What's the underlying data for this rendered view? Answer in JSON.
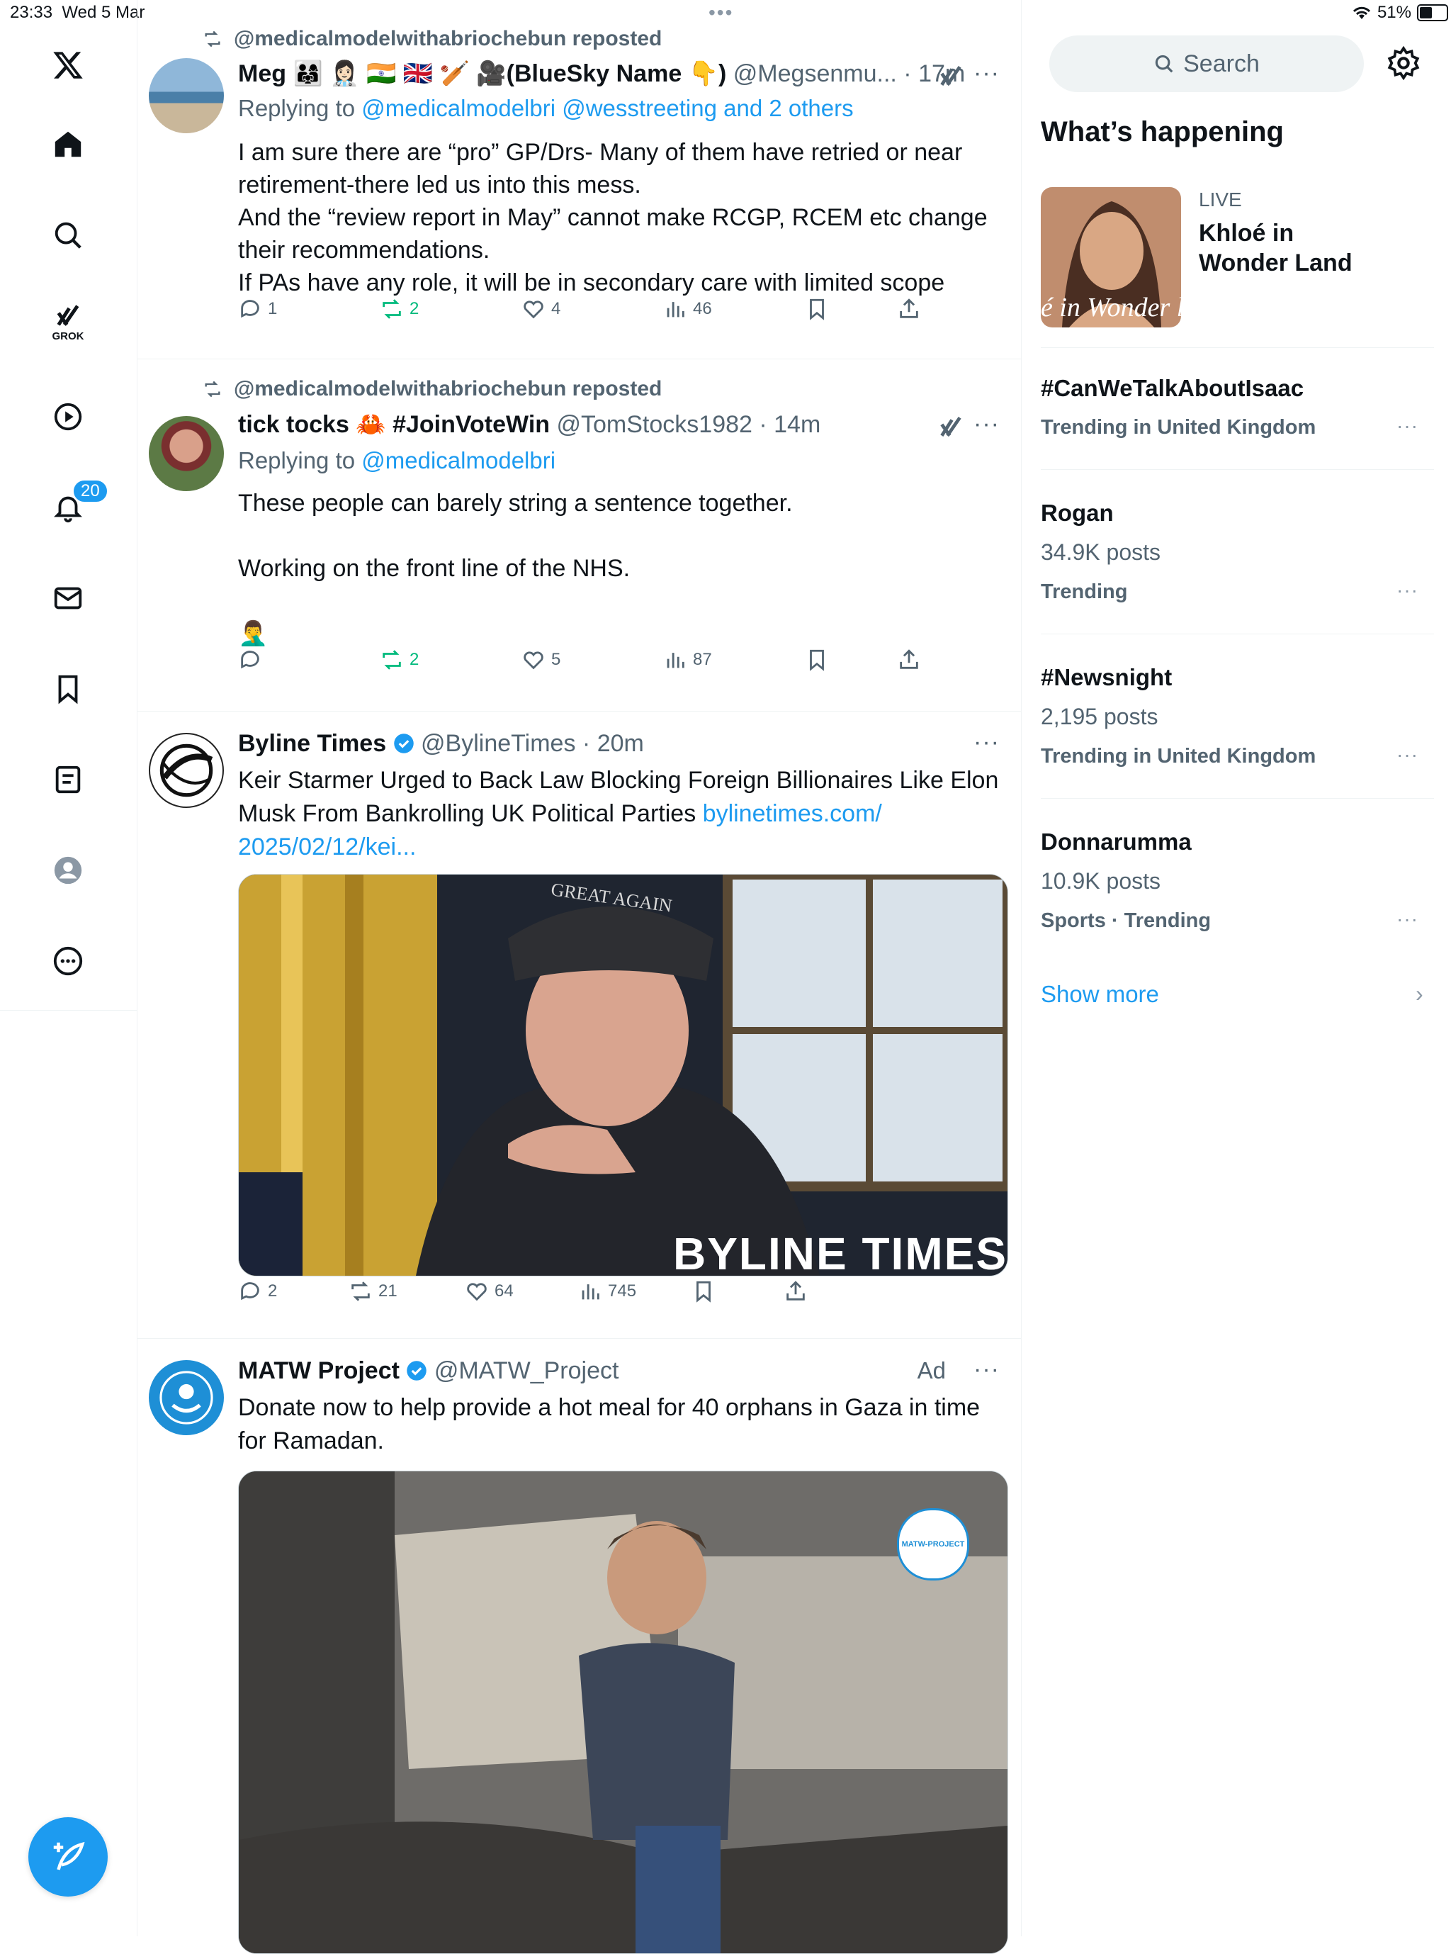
{
  "status_bar": {
    "time": "23:33",
    "date": "Wed 5 Mar",
    "battery": "51%",
    "battery_level": 0.51
  },
  "nav": {
    "grok_label": "GROK",
    "notifications_badge": "20",
    "icons": [
      "x-logo-icon",
      "home-icon",
      "search-icon",
      "grok-icon",
      "video-icon",
      "bell-icon",
      "mail-icon",
      "bookmark-icon",
      "list-icon",
      "profile-icon",
      "more-icon"
    ]
  },
  "tweets": [
    {
      "repost_by": "@medicalmodelwithabriochebun reposted",
      "name": "Meg 👨‍👩‍👧 👩🏻‍⚕️ 🇮🇳 🇬🇧 🏏 🎥(BlueSky Name 👇)",
      "handle": "@Megsenmu...",
      "time": "17m",
      "reply_to_prefix": "Replying to",
      "reply_to": "@medicalmodelbri @wesstreeting and 2 others",
      "text": "I am sure there are “pro” GP/Drs- Many of them have retried or near retirement-there led us into this mess.\nAnd the “review report in May” cannot make RCGP, RCEM etc change their recommendations.\nIf PAs have any role, it will be in secondary care with limited scope",
      "replies": "1",
      "reposts": "2",
      "likes": "4",
      "views": "46"
    },
    {
      "repost_by": "@medicalmodelwithabriochebun reposted",
      "name": "tick tocks 🦀 #JoinVoteWin",
      "handle": "@TomStocks1982",
      "time": "14m",
      "reply_to_prefix": "Replying to",
      "reply_to": "@medicalmodelbri",
      "text": "These people can barely string a sentence together.\n\nWorking on the front line of the NHS.\n\n🤦‍♂️",
      "replies": "",
      "reposts": "2",
      "likes": "5",
      "views": "87"
    },
    {
      "name": "Byline Times",
      "handle": "@BylineTimes",
      "time": "20m",
      "text": "Keir Starmer Urged to Back Law Blocking Foreign Billionaires Like Elon Musk From Bankrolling UK Political Parties",
      "link": "bylinetimes.com/ 2025/02/12/kei...",
      "image_text": "BYLINE TIMES",
      "cap_text": "GREAT AGAIN",
      "replies": "2",
      "reposts": "21",
      "likes": "64",
      "views": "745"
    },
    {
      "name": "MATW Project",
      "handle": "@MATW_Project",
      "ad_label": "Ad",
      "text": "Donate now to help provide a hot meal for 40 orphans in Gaza in time for Ramadan.",
      "image_watermark": "MATW-PROJECT"
    }
  ],
  "sidebar": {
    "search_placeholder": "Search",
    "title": "What’s happening",
    "live": {
      "label": "LIVE",
      "title": "Khloé in Wonder Land",
      "image_text": "é in Wonder l"
    },
    "trends": [
      {
        "title": "#CanWeTalkAboutIsaac",
        "posts": "",
        "meta": "Trending in United Kingdom"
      },
      {
        "title": "Rogan",
        "posts": "34.9K posts",
        "meta": "Trending"
      },
      {
        "title": "#Newsnight",
        "posts": "2,195 posts",
        "meta": "Trending in United Kingdom"
      },
      {
        "title": "Donnarumma",
        "posts": "10.9K posts",
        "meta": "Sports · Trending"
      }
    ],
    "show_more": "Show more"
  },
  "colors": {
    "accent": "#1d9bf0",
    "repost_green": "#00ba7c",
    "muted": "#536471",
    "text": "#0f1419"
  }
}
